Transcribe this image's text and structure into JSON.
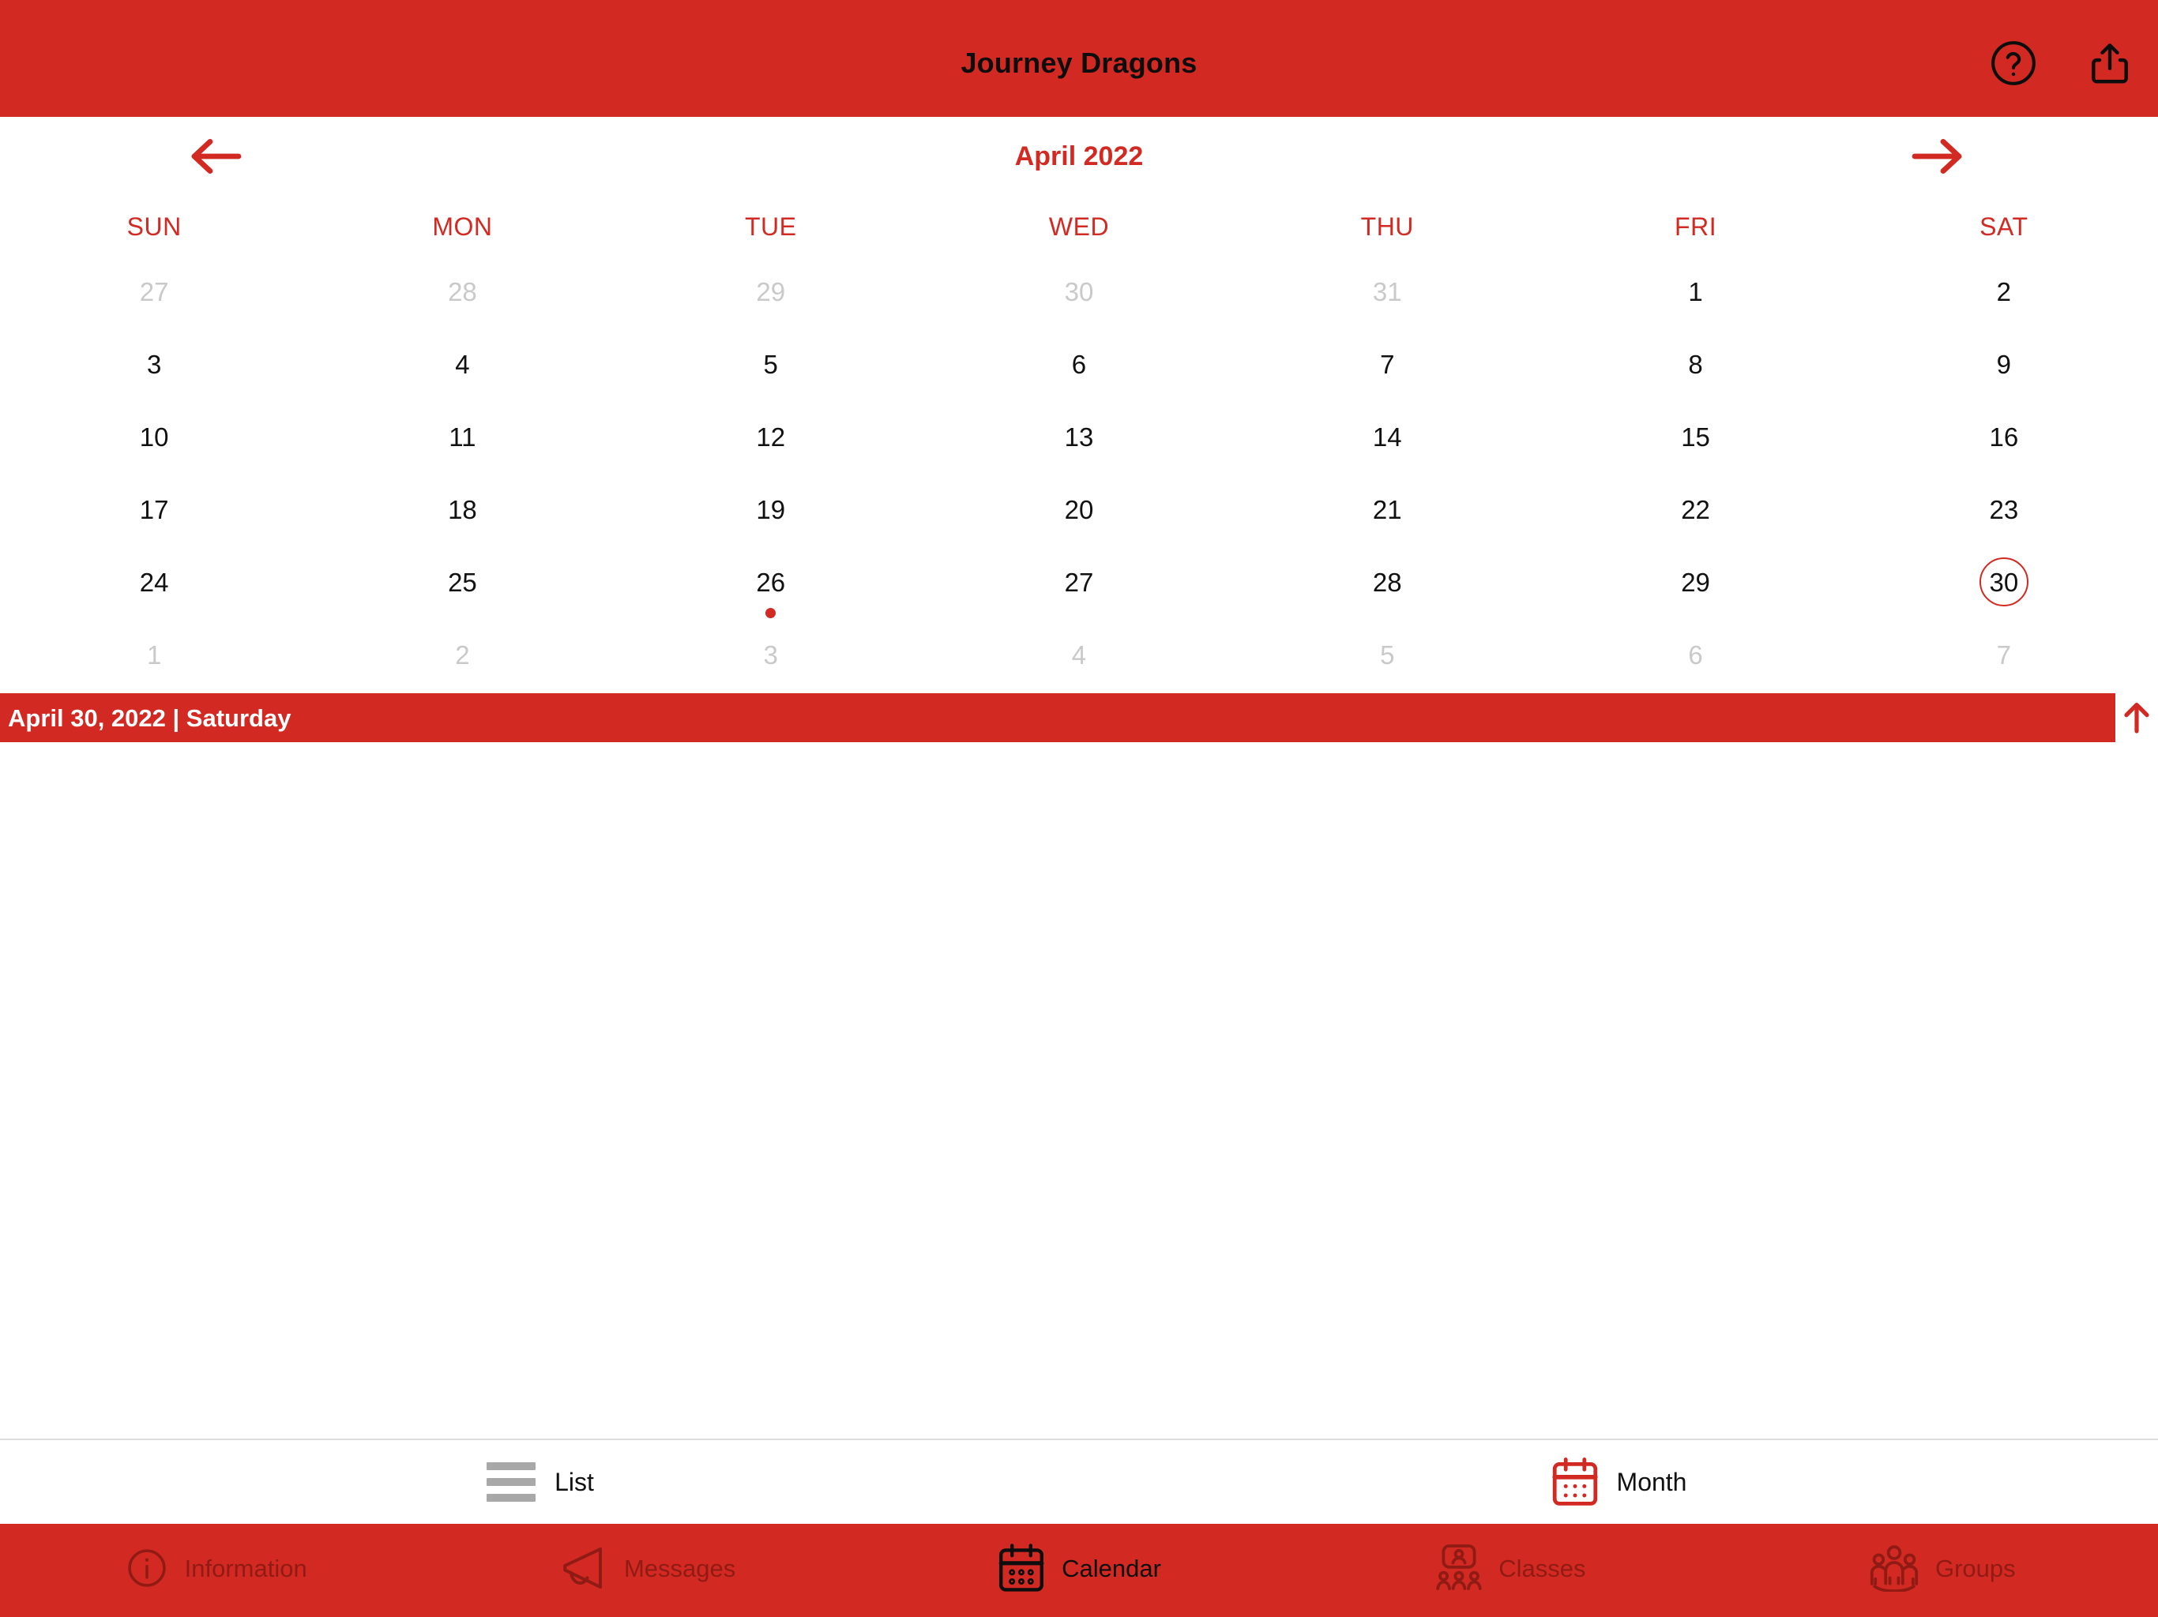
{
  "topbar": {
    "title": "Journey Dragons",
    "help_icon": "help-circle-icon",
    "share_icon": "share-icon"
  },
  "calendar": {
    "month_label": "April 2022",
    "prev_icon": "arrow-left-icon",
    "next_icon": "arrow-right-icon",
    "weekdays": [
      "SUN",
      "MON",
      "TUE",
      "WED",
      "THU",
      "FRI",
      "SAT"
    ],
    "weeks": [
      [
        {
          "day": "27",
          "outside": true,
          "selected": false,
          "dot": false
        },
        {
          "day": "28",
          "outside": true,
          "selected": false,
          "dot": false
        },
        {
          "day": "29",
          "outside": true,
          "selected": false,
          "dot": false
        },
        {
          "day": "30",
          "outside": true,
          "selected": false,
          "dot": false
        },
        {
          "day": "31",
          "outside": true,
          "selected": false,
          "dot": false
        },
        {
          "day": "1",
          "outside": false,
          "selected": false,
          "dot": false
        },
        {
          "day": "2",
          "outside": false,
          "selected": false,
          "dot": false
        }
      ],
      [
        {
          "day": "3",
          "outside": false,
          "selected": false,
          "dot": false
        },
        {
          "day": "4",
          "outside": false,
          "selected": false,
          "dot": false
        },
        {
          "day": "5",
          "outside": false,
          "selected": false,
          "dot": false
        },
        {
          "day": "6",
          "outside": false,
          "selected": false,
          "dot": false
        },
        {
          "day": "7",
          "outside": false,
          "selected": false,
          "dot": false
        },
        {
          "day": "8",
          "outside": false,
          "selected": false,
          "dot": false
        },
        {
          "day": "9",
          "outside": false,
          "selected": false,
          "dot": false
        }
      ],
      [
        {
          "day": "10",
          "outside": false,
          "selected": false,
          "dot": false
        },
        {
          "day": "11",
          "outside": false,
          "selected": false,
          "dot": false
        },
        {
          "day": "12",
          "outside": false,
          "selected": false,
          "dot": false
        },
        {
          "day": "13",
          "outside": false,
          "selected": false,
          "dot": false
        },
        {
          "day": "14",
          "outside": false,
          "selected": false,
          "dot": false
        },
        {
          "day": "15",
          "outside": false,
          "selected": false,
          "dot": false
        },
        {
          "day": "16",
          "outside": false,
          "selected": false,
          "dot": false
        }
      ],
      [
        {
          "day": "17",
          "outside": false,
          "selected": false,
          "dot": false
        },
        {
          "day": "18",
          "outside": false,
          "selected": false,
          "dot": false
        },
        {
          "day": "19",
          "outside": false,
          "selected": false,
          "dot": false
        },
        {
          "day": "20",
          "outside": false,
          "selected": false,
          "dot": false
        },
        {
          "day": "21",
          "outside": false,
          "selected": false,
          "dot": false
        },
        {
          "day": "22",
          "outside": false,
          "selected": false,
          "dot": false
        },
        {
          "day": "23",
          "outside": false,
          "selected": false,
          "dot": false
        }
      ],
      [
        {
          "day": "24",
          "outside": false,
          "selected": false,
          "dot": false
        },
        {
          "day": "25",
          "outside": false,
          "selected": false,
          "dot": false
        },
        {
          "day": "26",
          "outside": false,
          "selected": false,
          "dot": true
        },
        {
          "day": "27",
          "outside": false,
          "selected": false,
          "dot": false
        },
        {
          "day": "28",
          "outside": false,
          "selected": false,
          "dot": false
        },
        {
          "day": "29",
          "outside": false,
          "selected": false,
          "dot": false
        },
        {
          "day": "30",
          "outside": false,
          "selected": true,
          "dot": false
        }
      ],
      [
        {
          "day": "1",
          "outside": true,
          "selected": false,
          "dot": false
        },
        {
          "day": "2",
          "outside": true,
          "selected": false,
          "dot": false
        },
        {
          "day": "3",
          "outside": true,
          "selected": false,
          "dot": false
        },
        {
          "day": "4",
          "outside": true,
          "selected": false,
          "dot": false
        },
        {
          "day": "5",
          "outside": true,
          "selected": false,
          "dot": false
        },
        {
          "day": "6",
          "outside": true,
          "selected": false,
          "dot": false
        },
        {
          "day": "7",
          "outside": true,
          "selected": false,
          "dot": false
        }
      ]
    ]
  },
  "datebar": {
    "text": "April 30, 2022 | Saturday",
    "collapse_icon": "arrow-up-icon"
  },
  "viewbar": {
    "segments": [
      {
        "label": "List",
        "icon": "list-icon",
        "active": false
      },
      {
        "label": "Month",
        "icon": "calendar-icon",
        "active": true
      }
    ]
  },
  "tabbar": {
    "tabs": [
      {
        "label": "Information",
        "icon": "info-circle-icon",
        "active": false
      },
      {
        "label": "Messages",
        "icon": "megaphone-icon",
        "active": false
      },
      {
        "label": "Calendar",
        "icon": "calendar-icon",
        "active": true
      },
      {
        "label": "Classes",
        "icon": "classes-icon",
        "active": false
      },
      {
        "label": "Groups",
        "icon": "groups-icon",
        "active": false
      }
    ]
  },
  "colors": {
    "brand_red": "#d22a22",
    "inactive_tab": "#8f1b14",
    "outside_day": "#c9c9c9",
    "list_icon_gray": "#a8a8a8"
  }
}
